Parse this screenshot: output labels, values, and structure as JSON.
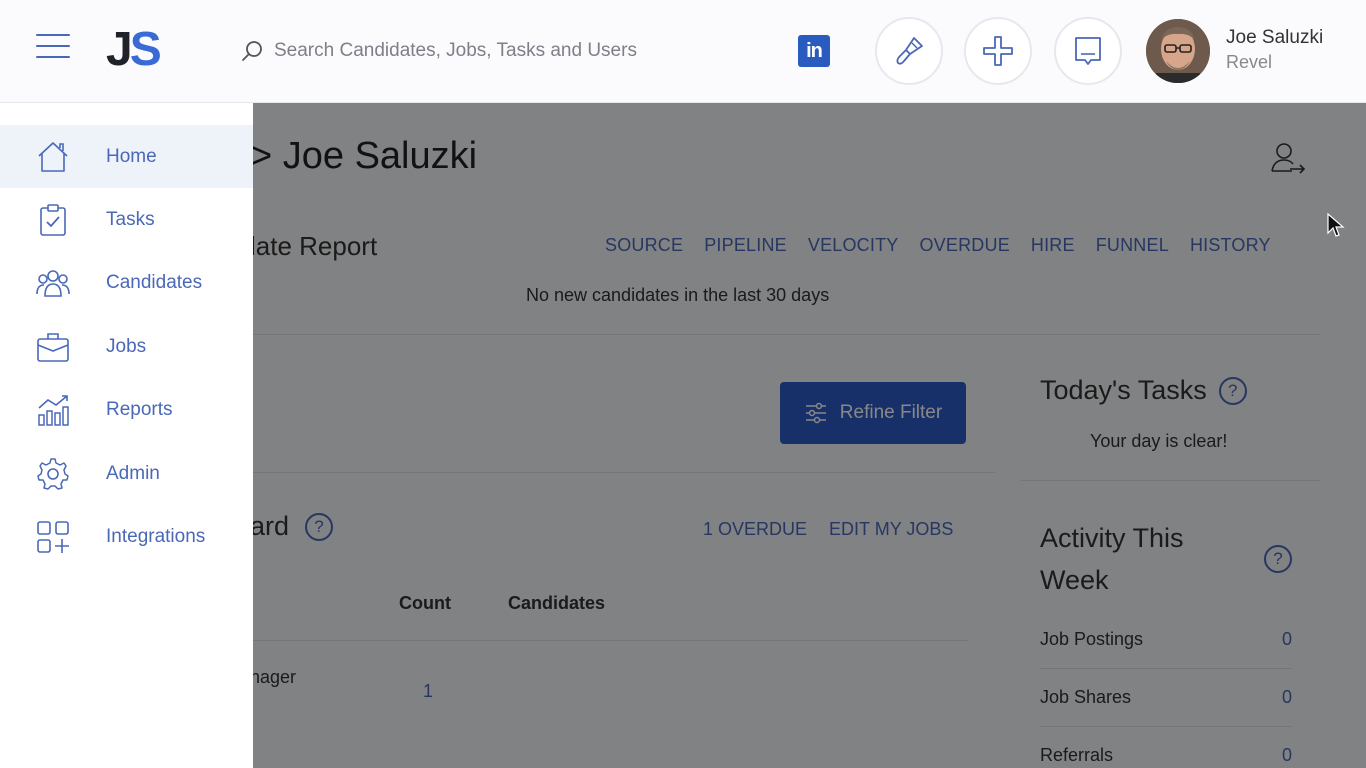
{
  "header": {
    "logo_j": "J",
    "logo_s": "S",
    "search_placeholder": "Search Candidates, Jobs, Tasks and Users",
    "linkedin_label": "in",
    "user_name": "Joe Saluzki",
    "user_org": "Revel"
  },
  "sidebar": {
    "items": [
      {
        "label": "Home",
        "icon": "home-icon",
        "active": true
      },
      {
        "label": "Tasks",
        "icon": "clipboard-icon"
      },
      {
        "label": "Candidates",
        "icon": "users-icon"
      },
      {
        "label": "Jobs",
        "icon": "briefcase-icon"
      },
      {
        "label": "Reports",
        "icon": "chart-icon"
      },
      {
        "label": "Admin",
        "icon": "gear-icon"
      },
      {
        "label": "Integrations",
        "icon": "grid-plus-icon"
      }
    ]
  },
  "main": {
    "title": "> Joe Saluzki",
    "report": {
      "title": "late Report",
      "tabs": [
        "SOURCE",
        "PIPELINE",
        "VELOCITY",
        "OVERDUE",
        "HIRE",
        "FUNNEL",
        "HISTORY"
      ],
      "empty_message": "No new candidates in the last 30 days"
    },
    "refine_filter_label": "Refine Filter",
    "tasks": {
      "title": "Today's Tasks",
      "help": "?",
      "empty_message": "Your day is clear!"
    },
    "board": {
      "title": "ard",
      "help": "?",
      "links": [
        "1 OVERDUE",
        "EDIT MY JOBS"
      ],
      "columns": {
        "count": "Count",
        "candidates": "Candidates"
      },
      "rows": [
        {
          "name": "nager",
          "count": "1"
        }
      ]
    },
    "activity": {
      "title": "Activity This Week",
      "help": "?",
      "rows": [
        {
          "label": "Job Postings",
          "value": "0"
        },
        {
          "label": "Job Shares",
          "value": "0"
        },
        {
          "label": "Referrals",
          "value": "0"
        }
      ]
    }
  },
  "colors": {
    "accent": "#4a68b8",
    "primary_button": "#2f5cc8",
    "logo_blue": "#3a6ad6"
  }
}
